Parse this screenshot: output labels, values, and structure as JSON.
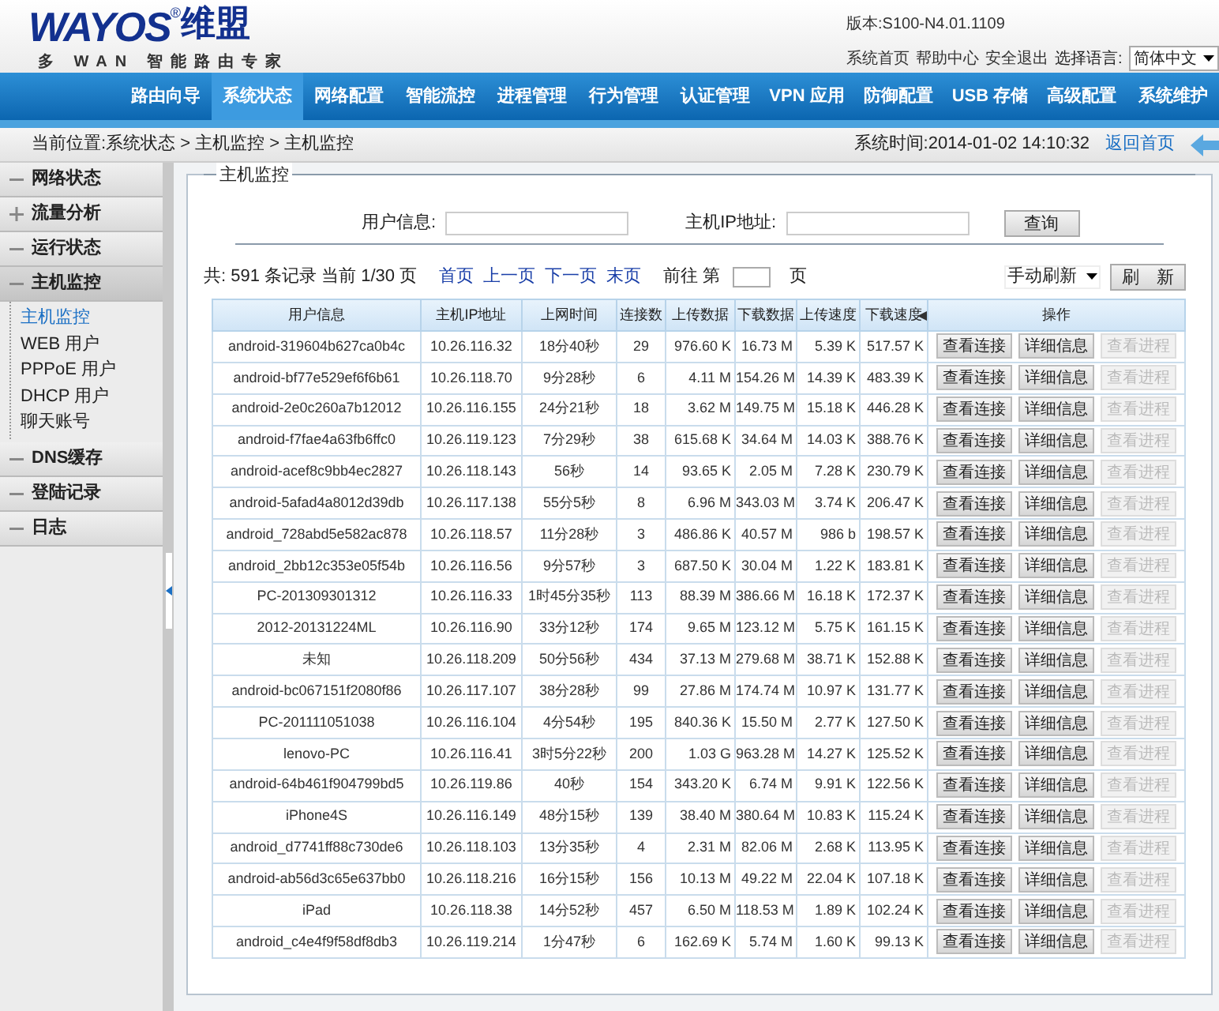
{
  "logo": {
    "brand": "WAYOS",
    "mark": "®",
    "chinese": "维盟",
    "tagline": "多 WAN 智能路由专家"
  },
  "header": {
    "version": "版本:S100-N4.01.1109",
    "links": [
      "系统首页",
      "帮助中心",
      "安全退出"
    ],
    "language_label": "选择语言:",
    "language": "简体中文"
  },
  "nav": [
    {
      "label": "路由向导",
      "selected": false
    },
    {
      "label": "系统状态",
      "selected": true
    },
    {
      "label": "网络配置",
      "selected": false
    },
    {
      "label": "智能流控",
      "selected": false
    },
    {
      "label": "进程管理",
      "selected": false
    },
    {
      "label": "行为管理",
      "selected": false
    },
    {
      "label": "认证管理",
      "selected": false
    },
    {
      "label": "VPN 应用",
      "selected": false
    },
    {
      "label": "防御配置",
      "selected": false
    },
    {
      "label": "USB 存储",
      "selected": false
    },
    {
      "label": "高级配置",
      "selected": false
    },
    {
      "label": "系统维护",
      "selected": false
    }
  ],
  "breadcrumb": "当前位置:系统状态 > 主机监控 > 主机监控",
  "system_time": "系统时间:2014-01-02 14:10:32",
  "back_home": "返回首页",
  "sidebar": [
    {
      "label": "网络状态",
      "expanded": true,
      "selected": false
    },
    {
      "label": "流量分析",
      "expanded": false,
      "selected": false
    },
    {
      "label": "运行状态",
      "expanded": true,
      "selected": false
    },
    {
      "label": "主机监控",
      "expanded": true,
      "selected": true,
      "children": [
        {
          "label": "主机监控",
          "selected": true
        },
        {
          "label": "WEB 用户",
          "selected": false
        },
        {
          "label": "PPPoE 用户",
          "selected": false
        },
        {
          "label": "DHCP 用户",
          "selected": false
        },
        {
          "label": "聊天账号",
          "selected": false
        }
      ]
    },
    {
      "label": "DNS缓存",
      "expanded": true,
      "selected": false
    },
    {
      "label": "登陆记录",
      "expanded": true,
      "selected": false
    },
    {
      "label": "日志",
      "expanded": true,
      "selected": false
    }
  ],
  "panel": {
    "title": "主机监控",
    "user_label": "用户信息:",
    "ip_label": "主机IP地址:",
    "query_button": "查询",
    "summary": "共: 591 条记录 当前 1/30 页",
    "pager_links": [
      "首页",
      "上一页",
      "下一页",
      "末页"
    ],
    "goto_label": "前往 第",
    "goto_suffix": "页",
    "refresh_mode": "手动刷新",
    "refresh_button": "刷　新"
  },
  "table": {
    "columns": [
      "用户信息",
      "主机IP地址",
      "上网时间",
      "连接数",
      "上传数据",
      "下载数据",
      "上传速度",
      "下载速度",
      "操作"
    ],
    "rows": [
      {
        "cells": [
          "android-319604b627ca0b4c",
          "10.26.116.32",
          "18分40秒",
          "29",
          "976.60 K",
          "16.73 M",
          "5.39 K",
          "517.57 K"
        ],
        "actions": [
          {
            "label": "查看连接",
            "disabled": false
          },
          {
            "label": "详细信息",
            "disabled": false
          },
          {
            "label": "查看进程",
            "disabled": true
          }
        ]
      },
      {
        "cells": [
          "android-bf77e529ef6f6b61",
          "10.26.118.70",
          "9分28秒",
          "6",
          "4.11 M",
          "154.26 M",
          "14.39 K",
          "483.39 K"
        ],
        "actions": [
          {
            "label": "查看连接",
            "disabled": false
          },
          {
            "label": "详细信息",
            "disabled": false
          },
          {
            "label": "查看进程",
            "disabled": true
          }
        ]
      },
      {
        "cells": [
          "android-2e0c260a7b12012",
          "10.26.116.155",
          "24分21秒",
          "18",
          "3.62 M",
          "149.75 M",
          "15.18 K",
          "446.28 K"
        ],
        "actions": [
          {
            "label": "查看连接",
            "disabled": false
          },
          {
            "label": "详细信息",
            "disabled": false
          },
          {
            "label": "查看进程",
            "disabled": true
          }
        ]
      },
      {
        "cells": [
          "android-f7fae4a63fb6ffc0",
          "10.26.119.123",
          "7分29秒",
          "38",
          "615.68 K",
          "34.64 M",
          "14.03 K",
          "388.76 K"
        ],
        "actions": [
          {
            "label": "查看连接",
            "disabled": false
          },
          {
            "label": "详细信息",
            "disabled": false
          },
          {
            "label": "查看进程",
            "disabled": true
          }
        ]
      },
      {
        "cells": [
          "android-acef8c9bb4ec2827",
          "10.26.118.143",
          "56秒",
          "14",
          "93.65 K",
          "2.05 M",
          "7.28 K",
          "230.79 K"
        ],
        "actions": [
          {
            "label": "查看连接",
            "disabled": false
          },
          {
            "label": "详细信息",
            "disabled": false
          },
          {
            "label": "查看进程",
            "disabled": true
          }
        ]
      },
      {
        "cells": [
          "android-5afad4a8012d39db",
          "10.26.117.138",
          "55分5秒",
          "8",
          "6.96 M",
          "343.03 M",
          "3.74 K",
          "206.47 K"
        ],
        "actions": [
          {
            "label": "查看连接",
            "disabled": false
          },
          {
            "label": "详细信息",
            "disabled": false
          },
          {
            "label": "查看进程",
            "disabled": true
          }
        ]
      },
      {
        "cells": [
          "android_728abd5e582ac878",
          "10.26.118.57",
          "11分28秒",
          "3",
          "486.86 K",
          "40.57 M",
          "986 b",
          "198.57 K"
        ],
        "actions": [
          {
            "label": "查看连接",
            "disabled": false
          },
          {
            "label": "详细信息",
            "disabled": false
          },
          {
            "label": "查看进程",
            "disabled": true
          }
        ]
      },
      {
        "cells": [
          "android_2bb12c353e05f54b",
          "10.26.116.56",
          "9分57秒",
          "3",
          "687.50 K",
          "30.04 M",
          "1.22 K",
          "183.81 K"
        ],
        "actions": [
          {
            "label": "查看连接",
            "disabled": false
          },
          {
            "label": "详细信息",
            "disabled": false
          },
          {
            "label": "查看进程",
            "disabled": true
          }
        ]
      },
      {
        "cells": [
          "PC-201309301312",
          "10.26.116.33",
          "1时45分35秒",
          "113",
          "88.39 M",
          "386.66 M",
          "16.18 K",
          "172.37 K"
        ],
        "actions": [
          {
            "label": "查看连接",
            "disabled": false
          },
          {
            "label": "详细信息",
            "disabled": false
          },
          {
            "label": "查看进程",
            "disabled": true
          }
        ]
      },
      {
        "cells": [
          "2012-20131224ML",
          "10.26.116.90",
          "33分12秒",
          "174",
          "9.65 M",
          "123.12 M",
          "5.75 K",
          "161.15 K"
        ],
        "actions": [
          {
            "label": "查看连接",
            "disabled": false
          },
          {
            "label": "详细信息",
            "disabled": false
          },
          {
            "label": "查看进程",
            "disabled": true
          }
        ]
      },
      {
        "cells": [
          "未知",
          "10.26.118.209",
          "50分56秒",
          "434",
          "37.13 M",
          "279.68 M",
          "38.71 K",
          "152.88 K"
        ],
        "actions": [
          {
            "label": "查看连接",
            "disabled": false
          },
          {
            "label": "详细信息",
            "disabled": false
          },
          {
            "label": "查看进程",
            "disabled": true
          }
        ]
      },
      {
        "cells": [
          "android-bc067151f2080f86",
          "10.26.117.107",
          "38分28秒",
          "99",
          "27.86 M",
          "174.74 M",
          "10.97 K",
          "131.77 K"
        ],
        "actions": [
          {
            "label": "查看连接",
            "disabled": false
          },
          {
            "label": "详细信息",
            "disabled": false
          },
          {
            "label": "查看进程",
            "disabled": true
          }
        ]
      },
      {
        "cells": [
          "PC-201111051038",
          "10.26.116.104",
          "4分54秒",
          "195",
          "840.36 K",
          "15.50 M",
          "2.77 K",
          "127.50 K"
        ],
        "actions": [
          {
            "label": "查看连接",
            "disabled": false
          },
          {
            "label": "详细信息",
            "disabled": false
          },
          {
            "label": "查看进程",
            "disabled": true
          }
        ]
      },
      {
        "cells": [
          "lenovo-PC",
          "10.26.116.41",
          "3时5分22秒",
          "200",
          "1.03 G",
          "963.28 M",
          "14.27 K",
          "125.52 K"
        ],
        "actions": [
          {
            "label": "查看连接",
            "disabled": false
          },
          {
            "label": "详细信息",
            "disabled": false
          },
          {
            "label": "查看进程",
            "disabled": true
          }
        ]
      },
      {
        "cells": [
          "android-64b461f904799bd5",
          "10.26.119.86",
          "40秒",
          "154",
          "343.20 K",
          "6.74 M",
          "9.91 K",
          "122.56 K"
        ],
        "actions": [
          {
            "label": "查看连接",
            "disabled": false
          },
          {
            "label": "详细信息",
            "disabled": false
          },
          {
            "label": "查看进程",
            "disabled": true
          }
        ]
      },
      {
        "cells": [
          "iPhone4S",
          "10.26.116.149",
          "48分15秒",
          "139",
          "38.40 M",
          "380.64 M",
          "10.83 K",
          "115.24 K"
        ],
        "actions": [
          {
            "label": "查看连接",
            "disabled": false
          },
          {
            "label": "详细信息",
            "disabled": false
          },
          {
            "label": "查看进程",
            "disabled": true
          }
        ]
      },
      {
        "cells": [
          "android_d7741ff88c730de6",
          "10.26.118.103",
          "13分35秒",
          "4",
          "2.31 M",
          "82.06 M",
          "2.68 K",
          "113.95 K"
        ],
        "actions": [
          {
            "label": "查看连接",
            "disabled": false
          },
          {
            "label": "详细信息",
            "disabled": false
          },
          {
            "label": "查看进程",
            "disabled": true
          }
        ]
      },
      {
        "cells": [
          "android-ab56d3c65e637bb0",
          "10.26.118.216",
          "16分15秒",
          "156",
          "10.13 M",
          "49.22 M",
          "22.04 K",
          "107.18 K"
        ],
        "actions": [
          {
            "label": "查看连接",
            "disabled": false
          },
          {
            "label": "详细信息",
            "disabled": false
          },
          {
            "label": "查看进程",
            "disabled": true
          }
        ]
      },
      {
        "cells": [
          "iPad",
          "10.26.118.38",
          "14分52秒",
          "457",
          "6.50 M",
          "118.53 M",
          "1.89 K",
          "102.24 K"
        ],
        "actions": [
          {
            "label": "查看连接",
            "disabled": false
          },
          {
            "label": "详细信息",
            "disabled": false
          },
          {
            "label": "查看进程",
            "disabled": true
          }
        ]
      },
      {
        "cells": [
          "android_c4e4f9f58df8db3",
          "10.26.119.214",
          "1分47秒",
          "6",
          "162.69 K",
          "5.74 M",
          "1.60 K",
          "99.13 K"
        ],
        "actions": [
          {
            "label": "查看连接",
            "disabled": false
          },
          {
            "label": "详细信息",
            "disabled": false
          },
          {
            "label": "查看进程",
            "disabled": true
          }
        ]
      }
    ]
  }
}
